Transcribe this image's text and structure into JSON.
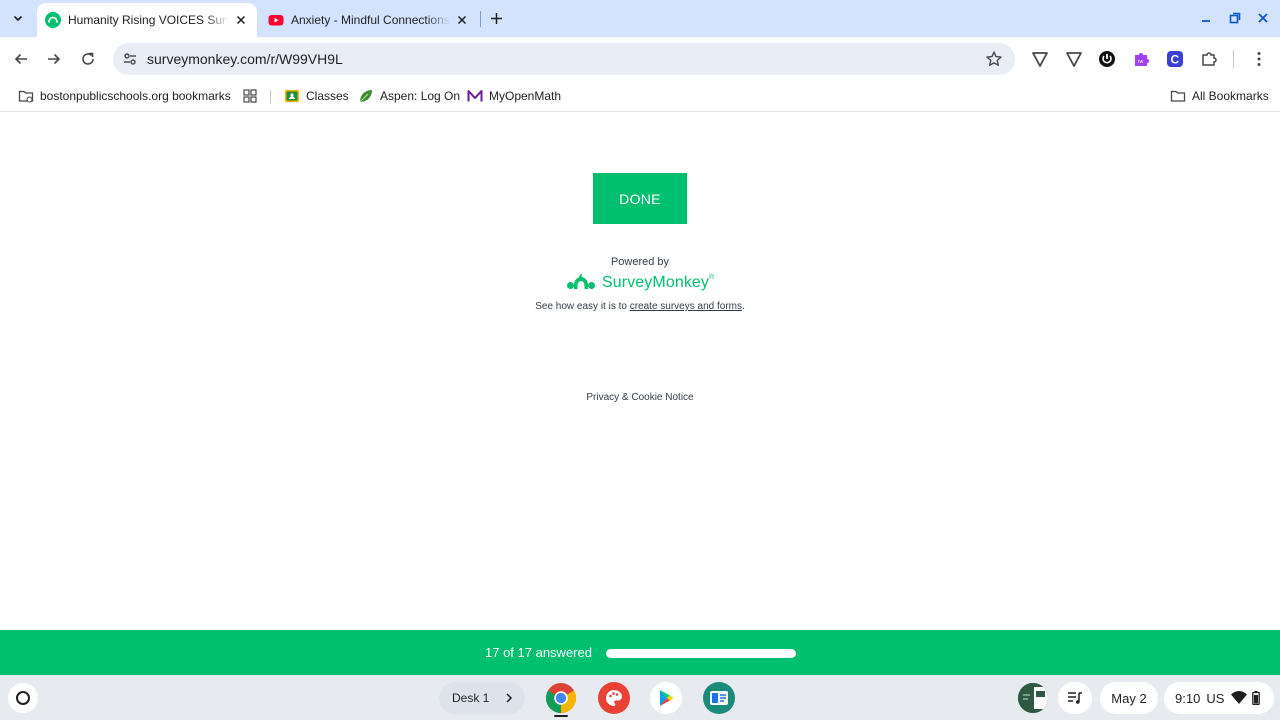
{
  "browser": {
    "tabs": [
      {
        "title": "Humanity Rising VOICES Surve",
        "active": true,
        "favicon": "surveymonkey-icon"
      },
      {
        "title": "Anxiety - Mindful Connections",
        "active": false,
        "favicon": "youtube-icon"
      }
    ],
    "url": "surveymonkey.com/r/W99VH9L",
    "bookmarks": [
      {
        "label": "bostonpublicschools.org bookmarks",
        "icon": "managed-folder-icon"
      },
      {
        "label": "",
        "icon": "apps-grid-icon"
      },
      {
        "label": "Classes",
        "icon": "google-classroom-icon"
      },
      {
        "label": "Aspen: Log On",
        "icon": "aspen-leaf-icon"
      },
      {
        "label": "MyOpenMath",
        "icon": "myopenmath-icon"
      }
    ],
    "all_bookmarks_label": "All Bookmarks"
  },
  "page": {
    "done_button": "DONE",
    "powered_by": "Powered by",
    "brand_name": "SurveyMonkey",
    "tagline_prefix": "See how easy it is to ",
    "tagline_link": "create surveys and forms",
    "tagline_suffix": ".",
    "privacy_notice": "Privacy & Cookie Notice"
  },
  "progress": {
    "label": "17 of 17 answered",
    "answered": 17,
    "total": 17
  },
  "shelf": {
    "desk_label": "Desk 1",
    "apps": [
      "chrome-icon",
      "canvas-paint-icon",
      "play-store-icon",
      "classroom-app-icon"
    ],
    "date": "May 2",
    "time": "9:10",
    "locale": "US"
  },
  "colors": {
    "brand_green": "#00bf6f",
    "tab_strip": "#d3e3fd",
    "shelf": "#e7ebf0"
  }
}
